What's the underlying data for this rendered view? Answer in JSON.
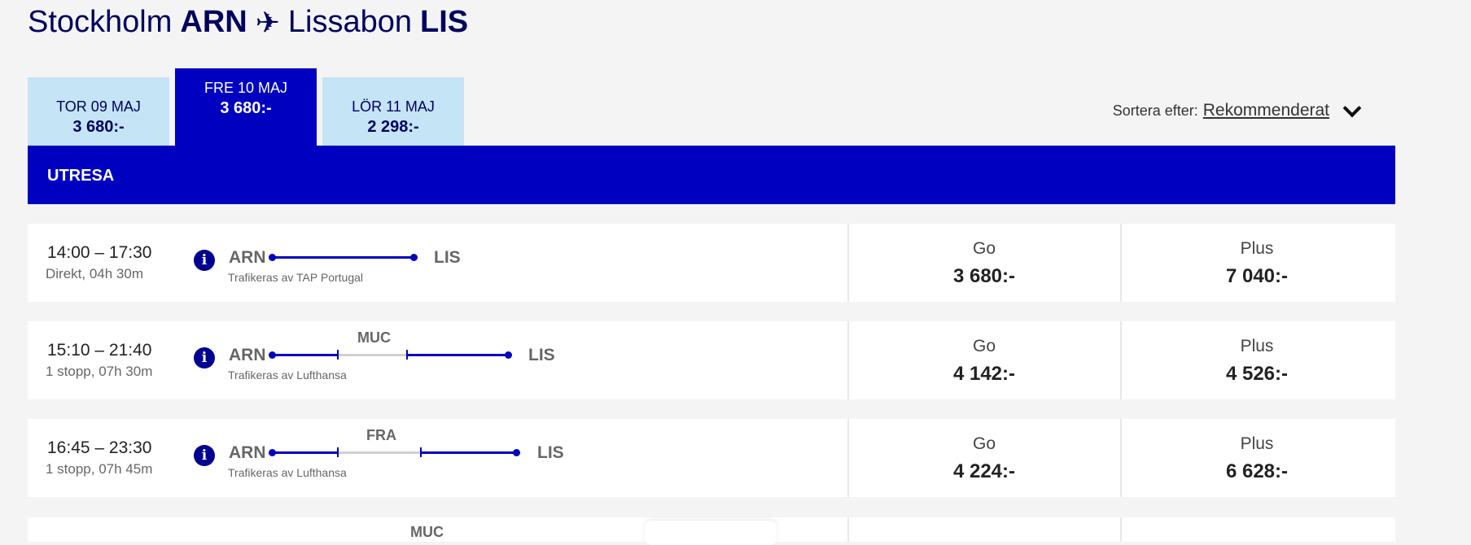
{
  "route": {
    "from_city": "Stockholm",
    "from_code": "ARN",
    "to_city": "Lissabon",
    "to_code": "LIS",
    "plane_icon": "✈"
  },
  "date_tabs": [
    {
      "date": "TOR 09 MAJ",
      "price": "3 680:-"
    },
    {
      "date": "FRE 10 MAJ",
      "price": "3 680:-",
      "active": true
    },
    {
      "date": "LÖR 11 MAJ",
      "price": "2 298:-"
    }
  ],
  "sort": {
    "label": "Sortera efter:",
    "value": "Rekommenderat"
  },
  "section": {
    "title": "UTRESA"
  },
  "flights": [
    {
      "time": "14:00 – 17:30",
      "stops": "Direkt, 04h 30m",
      "from": "ARN",
      "to": "LIS",
      "via": "",
      "operator": "Trafikeras av TAP Portugal",
      "fares": [
        {
          "name": "Go",
          "price": "3 680:-"
        },
        {
          "name": "Plus",
          "price": "7 040:-"
        }
      ]
    },
    {
      "time": "15:10 – 21:40",
      "stops": "1 stopp, 07h 30m",
      "from": "ARN",
      "to": "LIS",
      "via": "MUC",
      "operator": "Trafikeras av Lufthansa",
      "fares": [
        {
          "name": "Go",
          "price": "4 142:-"
        },
        {
          "name": "Plus",
          "price": "4 526:-"
        }
      ]
    },
    {
      "time": "16:45 – 23:30",
      "stops": "1 stopp, 07h 45m",
      "from": "ARN",
      "to": "LIS",
      "via": "FRA",
      "operator": "Trafikeras av Lufthansa",
      "fares": [
        {
          "name": "Go",
          "price": "4 224:-"
        },
        {
          "name": "Plus",
          "price": "6 628:-"
        }
      ]
    }
  ],
  "partial_row": {
    "via": "MUC"
  },
  "colors": {
    "brand": "#0000c0",
    "tab_inactive": "#c5e4f5",
    "title": "#000060"
  }
}
